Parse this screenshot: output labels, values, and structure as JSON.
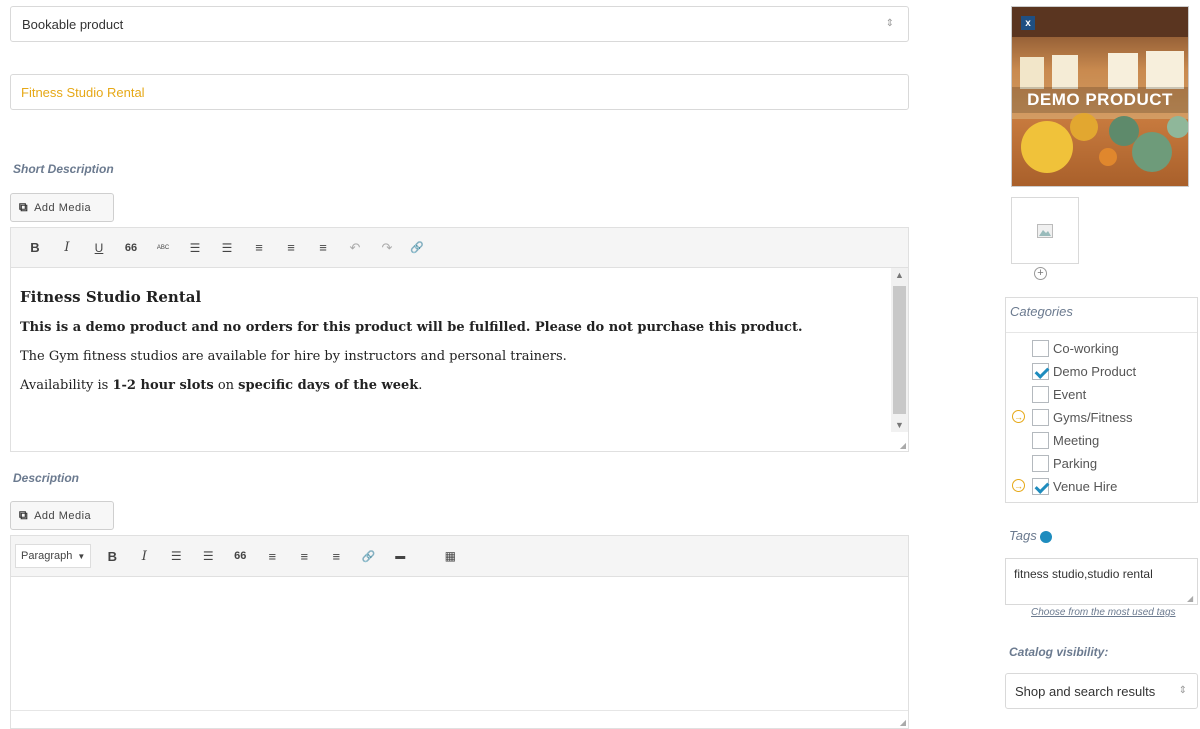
{
  "product_type": {
    "value": "Bookable product",
    "arrows": "⇕"
  },
  "title_field": {
    "value": "Fitness Studio Rental"
  },
  "short_description": {
    "label": "Short Description",
    "add_media": "Add Media",
    "content": {
      "heading": "Fitness Studio Rental",
      "warning": "This is a demo product and no orders for this product will be fulfilled. Please do not purchase this product.",
      "line1": "The Gym fitness studios are available for hire by instructors and personal trainers.",
      "line2_prefix": "Availability is ",
      "line2_bold1": "1-2 hour slots",
      "line2_mid": " on ",
      "line2_bold2": "specific days of the week",
      "line2_end": "."
    },
    "toolbar": {
      "bold": "B",
      "italic": "I",
      "underline": "U",
      "quote": "66",
      "strike": "ABC",
      "ul": "☰",
      "ol": "☰",
      "align_left": "≡",
      "align_center": "≡",
      "align_right": "≡",
      "undo": "↶",
      "redo": "↷",
      "link": "🔗"
    }
  },
  "description": {
    "label": "Description",
    "add_media": "Add Media",
    "toolbar": {
      "format": "Paragraph",
      "bold": "B",
      "italic": "I",
      "ul": "☰",
      "ol": "☰",
      "quote": "66",
      "align_left": "≡",
      "align_center": "≡",
      "align_right": "≡",
      "link": "🔗",
      "more": "▬",
      "kitchen_sink": "▦"
    }
  },
  "image": {
    "overlay_text": "DEMO PRODUCT",
    "remove": "x"
  },
  "gallery": {
    "add": "+"
  },
  "categories": {
    "title": "Categories",
    "items": [
      {
        "label": "Co-working",
        "checked": false,
        "marker": false
      },
      {
        "label": "Demo Product",
        "checked": true,
        "marker": false
      },
      {
        "label": "Event",
        "checked": false,
        "marker": false
      },
      {
        "label": "Gyms/Fitness",
        "checked": false,
        "marker": true
      },
      {
        "label": "Meeting",
        "checked": false,
        "marker": false
      },
      {
        "label": "Parking",
        "checked": false,
        "marker": false
      },
      {
        "label": "Venue Hire",
        "checked": true,
        "marker": true
      }
    ]
  },
  "tags": {
    "title": "Tags",
    "value": "fitness studio,studio rental",
    "choose_link": "Choose from the most used tags"
  },
  "catalog_visibility": {
    "title": "Catalog visibility:",
    "value": "Shop and search results"
  },
  "colors": {
    "accent": "#e6a817",
    "label": "#6b7a8f",
    "check": "#1e8cbe"
  }
}
